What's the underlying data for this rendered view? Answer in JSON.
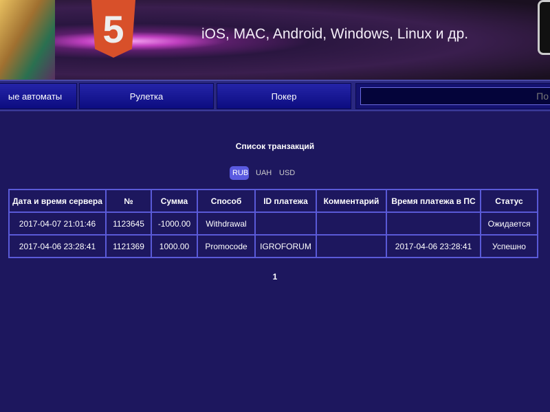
{
  "banner": {
    "logo_text": "5",
    "tagline": "iOS, MAC, Android, Windows, Linux и др."
  },
  "nav": {
    "items": [
      {
        "label": "ые автоматы"
      },
      {
        "label": "Рулетка"
      },
      {
        "label": "Покер"
      }
    ],
    "search_placeholder": "По"
  },
  "main": {
    "title": "Список транзакций",
    "currencies": [
      "RUB",
      "UAH",
      "USD"
    ],
    "active_currency": "RUB",
    "table": {
      "headers": [
        "Дата и время сервера",
        "№",
        "Сумма",
        "Способ",
        "ID платежа",
        "Комментарий",
        "Время платежа в ПС",
        "Статус"
      ],
      "rows": [
        [
          "2017-04-07 21:01:46",
          "1123645",
          "-1000.00",
          "Withdrawal",
          "",
          "",
          "",
          "Ожидается"
        ],
        [
          "2017-04-06 23:28:41",
          "1121369",
          "1000.00",
          "Promocode",
          "IGROFORUM",
          "",
          "2017-04-06 23:28:41",
          "Успешно"
        ]
      ]
    },
    "page": "1"
  }
}
